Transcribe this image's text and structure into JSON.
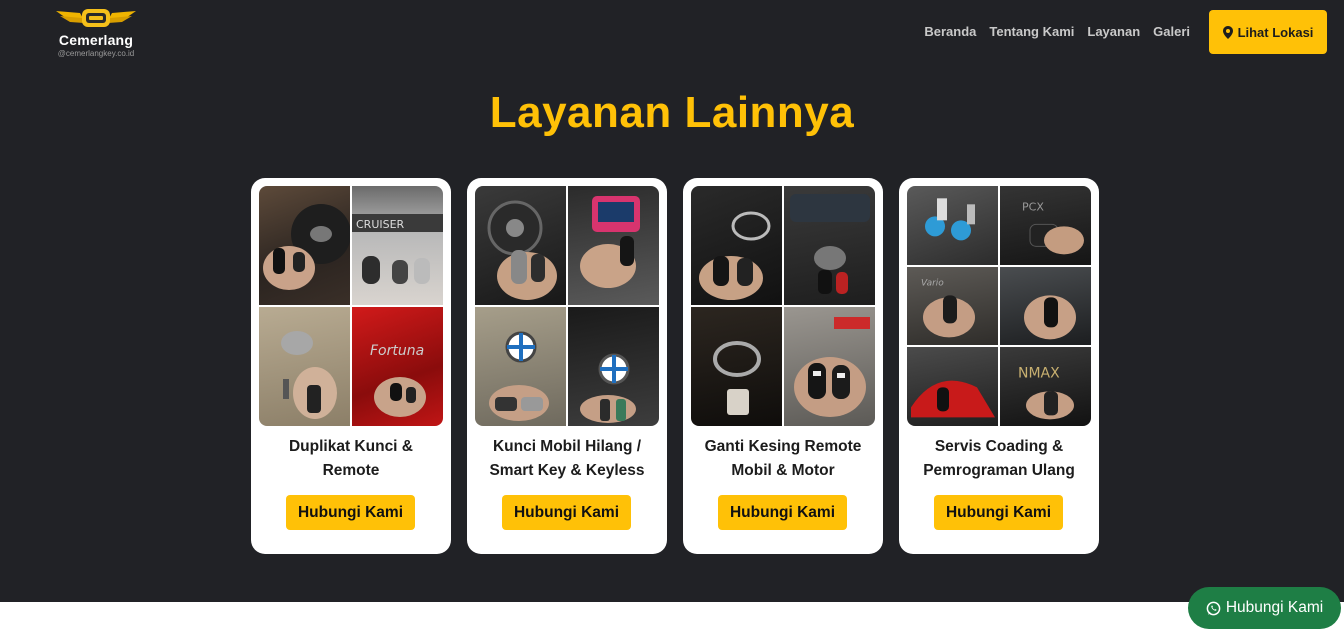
{
  "brand": {
    "name": "Cemerlang",
    "site": "@cemerlangkey.co.id"
  },
  "nav": {
    "items": [
      {
        "label": "Beranda"
      },
      {
        "label": "Tentang Kami"
      },
      {
        "label": "Layanan"
      },
      {
        "label": "Galeri"
      }
    ],
    "location_button": {
      "label": "Lihat Lokasi",
      "icon": "map-pin-icon"
    }
  },
  "section": {
    "title": "Layanan Lainnya"
  },
  "cards": [
    {
      "title": "Duplikat Kunci & Remote",
      "cta": "Hubungi Kami",
      "photo_tiles": [
        "steering-wheel-keys",
        "land-cruiser-keys",
        "nissan-wheel-key",
        "red-car-remote"
      ]
    },
    {
      "title": "Kunci Mobil Hilang / Smart Key & Keyless",
      "cta": "Hubungi Kami",
      "photo_tiles": [
        "nissan-smart-key",
        "key-programmer-device",
        "bmw-dashboard-key",
        "bmw-wheel-key"
      ]
    },
    {
      "title": "Ganti Kesing Remote Mobil & Motor",
      "cta": "Hubungi Kami",
      "photo_tiles": [
        "toyota-smart-key",
        "honda-key-dashboard",
        "toyota-wheel-key",
        "honda-remote-pair"
      ]
    },
    {
      "title": "Servis Coading & Pemrograman Ulang",
      "cta": "Hubungi Kami",
      "photo_tiles": [
        "key-blanks",
        "motor-key-fob",
        "motorcycle-key-1",
        "motorcycle-key-2",
        "red-scooter-key",
        "nmax-key"
      ]
    }
  ],
  "whatsapp": {
    "label": "Hubungi Kami",
    "icon": "whatsapp-icon",
    "color": "#1e7e45"
  },
  "colors": {
    "accent": "#ffc107",
    "background": "#212226"
  }
}
